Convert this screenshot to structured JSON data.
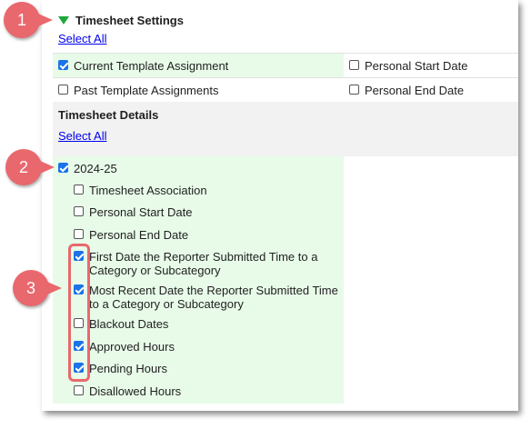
{
  "settings": {
    "title": "Timesheet Settings",
    "select_all": "Select All",
    "options": [
      {
        "label": "Current Template Assignment",
        "checked": true
      },
      {
        "label": "Personal Start Date",
        "checked": false
      },
      {
        "label": "Past Template Assignments",
        "checked": false
      },
      {
        "label": "Personal End Date",
        "checked": false
      }
    ]
  },
  "details": {
    "title": "Timesheet Details",
    "select_all": "Select All",
    "year": {
      "label": "2024-25",
      "checked": true
    },
    "items": [
      {
        "label": "Timesheet Association",
        "checked": false
      },
      {
        "label": "Personal Start Date",
        "checked": false
      },
      {
        "label": "Personal End Date",
        "checked": false
      },
      {
        "label_line1": "First Date the Reporter Submitted Time to a",
        "label_line2": "Category or Subcategory",
        "checked": true
      },
      {
        "label_line1": "Most Recent Date the Reporter Submitted Time",
        "label_line2": "to a Category or Subcategory",
        "checked": true
      },
      {
        "label": "Blackout Dates",
        "checked": false
      },
      {
        "label": "Approved Hours",
        "checked": true
      },
      {
        "label": "Pending Hours",
        "checked": true
      },
      {
        "label": "Disallowed Hours",
        "checked": false
      }
    ]
  },
  "callouts": [
    "1",
    "2",
    "3"
  ],
  "colors": {
    "accent": "#1a73e8",
    "callout": "#e9686d",
    "green_bg": "#e8fbe9",
    "triangle": "#1fa83a"
  }
}
